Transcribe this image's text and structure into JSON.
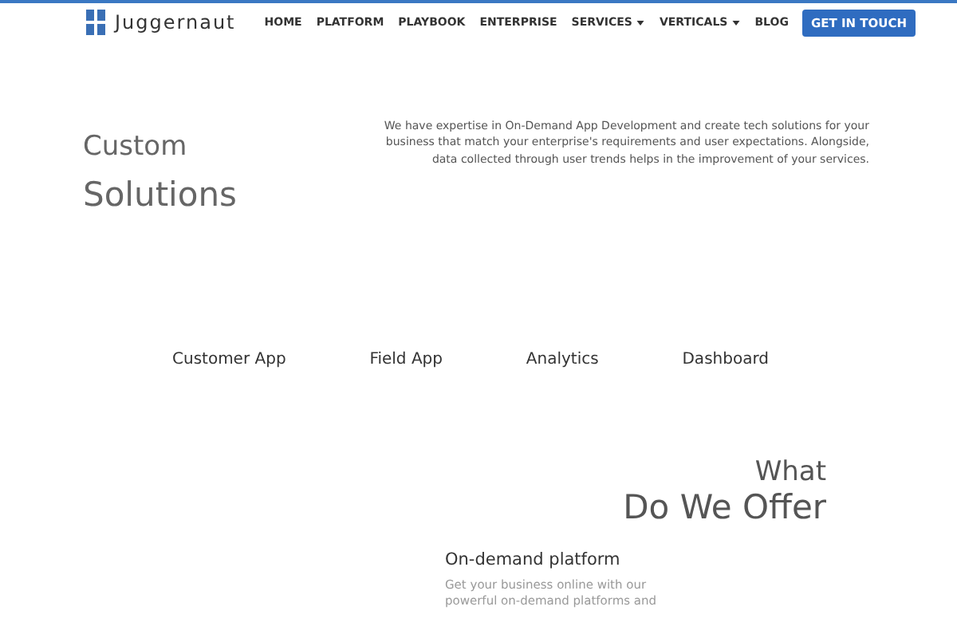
{
  "brand": {
    "name": "Juggernaut"
  },
  "nav": [
    {
      "label": "HOME",
      "dropdown": false
    },
    {
      "label": "PLATFORM",
      "dropdown": false
    },
    {
      "label": "PLAYBOOK",
      "dropdown": false
    },
    {
      "label": "ENTERPRISE",
      "dropdown": false
    },
    {
      "label": "SERVICES",
      "dropdown": true
    },
    {
      "label": "VERTICALS",
      "dropdown": true
    },
    {
      "label": "BLOG",
      "dropdown": false
    }
  ],
  "cta": "GET IN TOUCH",
  "hero": {
    "title_line_1": "Custom",
    "title_line_2": "Solutions",
    "text": "We have expertise in On-Demand App Development and create tech solutions for your business that match your enterprise's requirements and user expectations. Alongside, data collected through user trends helps in the improvement of your services."
  },
  "tabs": [
    {
      "label": "Customer App"
    },
    {
      "label": "Field App"
    },
    {
      "label": "Analytics"
    },
    {
      "label": "Dashboard"
    }
  ],
  "offer": {
    "title_line_1": "What",
    "title_line_2": "Do We Offer"
  },
  "feature": {
    "title": "On-demand platform",
    "text": "Get your business online with our powerful on-demand platforms and"
  }
}
